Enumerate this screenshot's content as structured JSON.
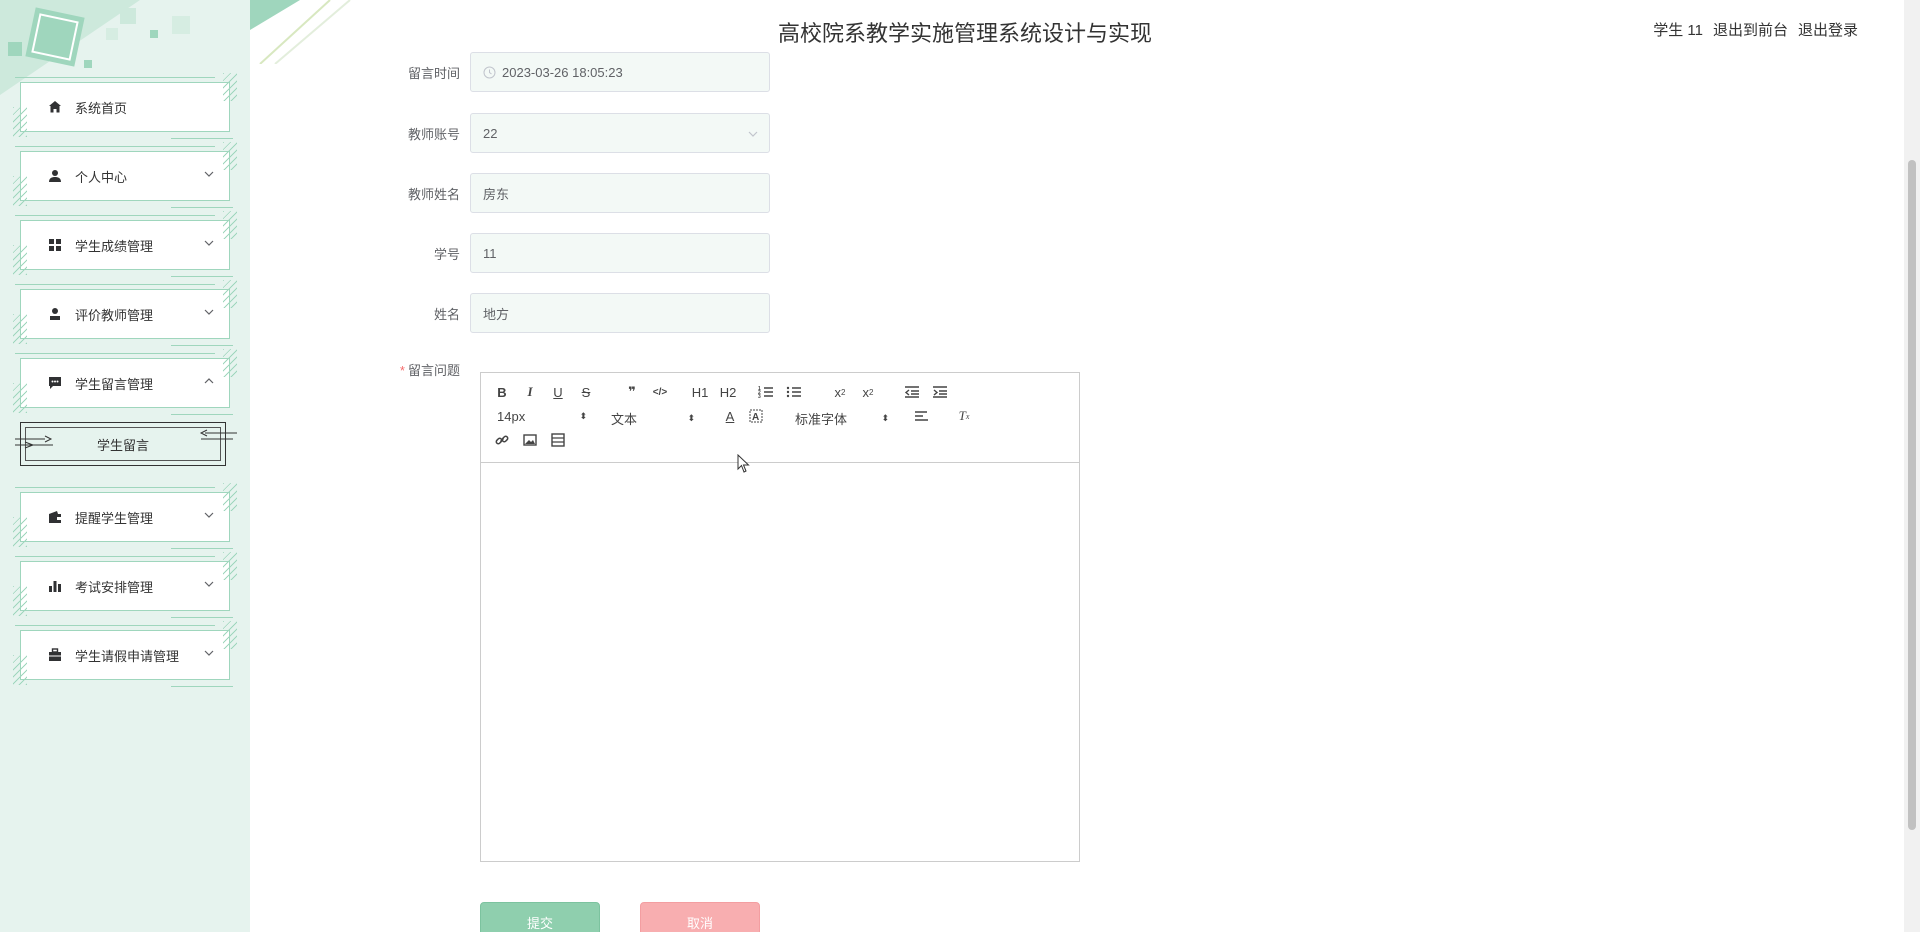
{
  "header": {
    "title": "高校院系教学实施管理系统设计与实现",
    "user": "学生 11",
    "to_front": "退出到前台",
    "logout": "退出登录"
  },
  "sidebar": {
    "items": [
      {
        "label": "系统首页",
        "icon": "home-icon"
      },
      {
        "label": "个人中心",
        "icon": "user-icon"
      },
      {
        "label": "学生成绩管理",
        "icon": "grid-icon"
      },
      {
        "label": "评价教师管理",
        "icon": "user-stamp-icon"
      },
      {
        "label": "学生留言管理",
        "icon": "chat-icon"
      },
      {
        "label": "提醒学生管理",
        "icon": "wallet-icon"
      },
      {
        "label": "考试安排管理",
        "icon": "bar-chart-icon"
      },
      {
        "label": "学生请假申请管理",
        "icon": "briefcase-icon"
      }
    ],
    "sub_item": "学生留言"
  },
  "form": {
    "time_label": "留言时间",
    "time_value": "2023-03-26 18:05:23",
    "teacher_account_label": "教师账号",
    "teacher_account_value": "22",
    "teacher_name_label": "教师姓名",
    "teacher_name_value": "房东",
    "student_id_label": "学号",
    "student_id_value": "11",
    "name_label": "姓名",
    "name_value": "地方",
    "question_label": "留言问题",
    "required_mark": "*"
  },
  "editor": {
    "font_size": "14px",
    "block_type": "文本",
    "font_family": "标准字体",
    "h1": "H1",
    "h2": "H2"
  },
  "buttons": {
    "submit": "提交",
    "cancel": "取消"
  },
  "colors": {
    "sidebar_bg": "#e6f3ee",
    "accent": "#8fcfae",
    "cancel": "#f8aeb0"
  }
}
